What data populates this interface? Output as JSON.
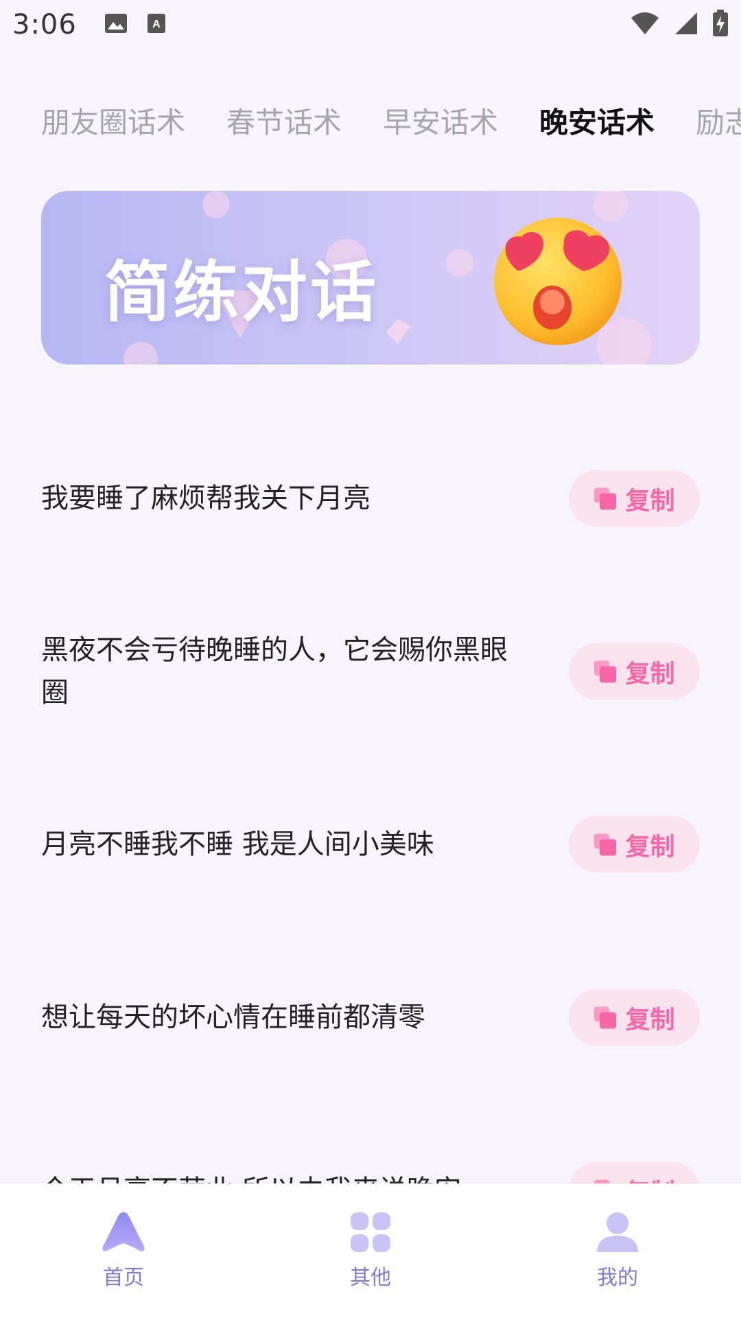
{
  "status_bar": {
    "time": "3:06",
    "icons": [
      "image-icon",
      "keyboard-a-icon",
      "wifi-icon",
      "signal-icon",
      "battery-charging-icon"
    ]
  },
  "tabs": [
    {
      "label": "朋友圈话术",
      "active": false
    },
    {
      "label": "春节话术",
      "active": false
    },
    {
      "label": "早安话术",
      "active": false
    },
    {
      "label": "晚安话术",
      "active": true
    },
    {
      "label": "励志",
      "active": false
    }
  ],
  "banner": {
    "title": "简练对话",
    "emoji": "heart-eyes-emoji"
  },
  "items": [
    {
      "text": "我要睡了麻烦帮我关下月亮",
      "copy_label": "复制"
    },
    {
      "text": " 黑夜不会亏待晚睡的人，它会赐你黑眼圈",
      "copy_label": "复制"
    },
    {
      "text": "月亮不睡我不睡 我是人间小美味",
      "copy_label": "复制"
    },
    {
      "text": "想让每天的坏心情在睡前都清零",
      "copy_label": "复制"
    },
    {
      "text": "今天月亮不营业 所以由我来说晚安",
      "copy_label": "复制"
    }
  ],
  "bottom_nav": [
    {
      "label": "首页",
      "icon": "home-icon"
    },
    {
      "label": "其他",
      "icon": "grid-icon"
    },
    {
      "label": "我的",
      "icon": "user-icon"
    }
  ],
  "colors": {
    "accent": "#7f7ad8",
    "copy_pink": "#f766a7",
    "copy_bg": "#fae3ef",
    "background": "#f7f4fb"
  }
}
